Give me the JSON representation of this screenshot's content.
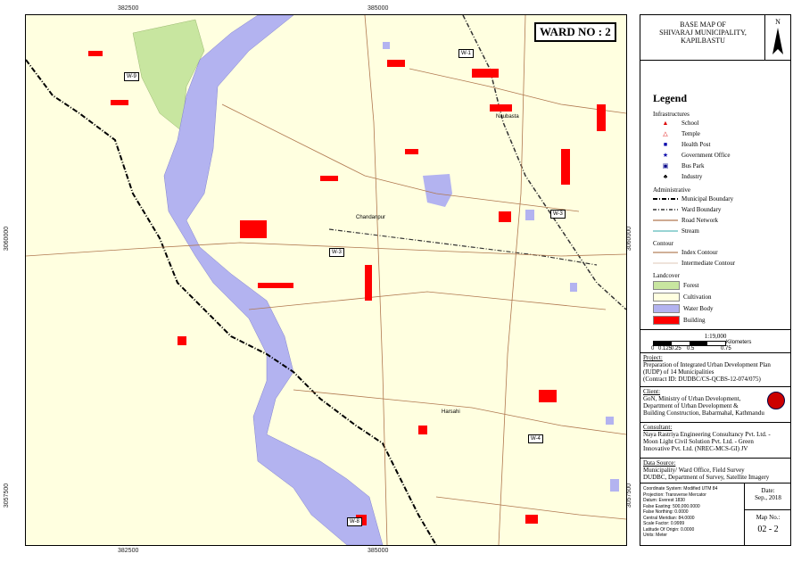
{
  "map": {
    "ward_title": "WARD NO : 2",
    "ticks_x": [
      "382500",
      "385000"
    ],
    "ticks_y": [
      "3060000",
      "3057500"
    ],
    "ward_tags": [
      "W-1",
      "W-9",
      "W-3",
      "W-3",
      "W-4",
      "W-8"
    ],
    "places": [
      "Naubasta",
      "Chandanpur",
      "Harsahi"
    ]
  },
  "panel": {
    "north": "N",
    "title": [
      "BASE MAP OF",
      "SHIVARAJ MUNICIPALITY,",
      "KAPILBASTU"
    ],
    "legend_title": "Legend",
    "groups": [
      {
        "name": "Infrastructures",
        "items": [
          {
            "label": "School",
            "icon": "school-icon"
          },
          {
            "label": "Temple",
            "icon": "temple-icon"
          },
          {
            "label": "Health Post",
            "icon": "health-post-icon"
          },
          {
            "label": "Government Office",
            "icon": "government-office-icon"
          },
          {
            "label": "Bus Park",
            "icon": "bus-park-icon"
          },
          {
            "label": "Industry",
            "icon": "industry-icon"
          }
        ]
      },
      {
        "name": "Administrative",
        "items": [
          {
            "label": "Municipal Boundary",
            "icon": "line"
          },
          {
            "label": "Ward Boundary",
            "icon": "line"
          },
          {
            "label": "Road Network",
            "icon": "line"
          },
          {
            "label": "Stream",
            "icon": "line"
          }
        ]
      },
      {
        "name": "Contour",
        "items": [
          {
            "label": "Index Contour",
            "icon": "line"
          },
          {
            "label": "Intermediate Contour",
            "icon": "line"
          }
        ]
      },
      {
        "name": "Landcover",
        "items": [
          {
            "label": "Forest",
            "icon": "fill",
            "color": "#c8e6a0"
          },
          {
            "label": "Cultivation",
            "icon": "fill",
            "color": "#ffffe0"
          },
          {
            "label": "Water Body",
            "icon": "fill",
            "color": "#b3b3f0"
          },
          {
            "label": "Building",
            "icon": "fill",
            "color": "#ff0000"
          }
        ]
      }
    ],
    "scale": "1:19,000",
    "scale_ticks": [
      "0",
      "0.125",
      "0.25",
      "0.5",
      "0.75"
    ],
    "scale_unit": "Kilometers",
    "project_title": "Project:",
    "project_lines": [
      "Preparation of Integrated Urban Development Plan",
      "(IUDP) of 14 Municipalities",
      "(Contract ID: DUDBC/CS-QCBS-12-074/075)"
    ],
    "client_title": "Client:",
    "client_lines": [
      "GoN, Ministry of Urban Development,",
      "Department of Urban Development &",
      "Building Construction, Babarmahal, Kathmandu"
    ],
    "consultant_title": "Consultant:",
    "consultant_lines": [
      "Naya Rastriya Engineering Consultancy Pvt. Ltd. -",
      "Moon Light Civil Solution Pvt. Ltd. - Green",
      "Innovative Pvt. Ltd. (NREC-MCS-GI) JV"
    ],
    "datasource_title": "Data Source:",
    "datasource_lines": [
      "Municipality/ Ward Office, Field Survey",
      "DUDBC, Department of Survey, Satellite Imagery"
    ],
    "coord_lines": [
      "Coordinate System: Modified UTM 84",
      "Projection: Transverse Mercator",
      "Datum: Everest 1830",
      "False Easting: 500,000.0000",
      "False Northing: 0.0000",
      "Central Meridian: 84.0000",
      "Scale Factor: 0.9999",
      "Latitude Of Origin: 0.0000",
      "Units: Meter"
    ],
    "date_label": "Date:",
    "date_value": "Sep., 2018",
    "mapno_label": "Map No.:",
    "mapno_value": "02 - 2"
  }
}
